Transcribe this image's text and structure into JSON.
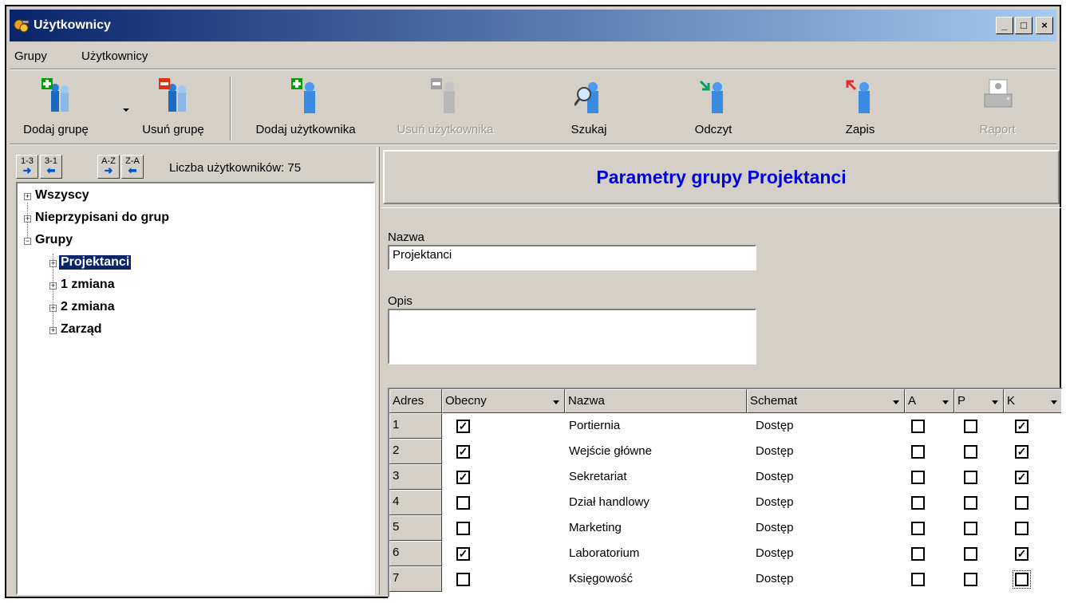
{
  "window": {
    "title": "Użytkownicy",
    "controls": {
      "minimize": "_",
      "maximize": "□",
      "close": "×"
    }
  },
  "menu": [
    {
      "label": "Grupy"
    },
    {
      "label": "Użytkownicy"
    }
  ],
  "toolbar": {
    "add_group": "Dodaj grupę",
    "remove_group": "Usuń grupę",
    "add_user": "Dodaj użytkownika",
    "remove_user": "Usuń użytkownika",
    "search": "Szukaj",
    "read": "Odczyt",
    "save": "Zapis",
    "report": "Raport"
  },
  "sort_buttons": [
    {
      "label": "1-3",
      "arrow": "➜"
    },
    {
      "label": "3-1",
      "arrow": "⬅"
    },
    {
      "label": "A-Z",
      "arrow": "➜"
    },
    {
      "label": "Z-A",
      "arrow": "⬅"
    }
  ],
  "user_count": "Liczba użytkowników: 75",
  "tree": {
    "all": "Wszyscy",
    "unassigned": "Nieprzypisani do grup",
    "groups": "Grupy",
    "group_items": [
      "Projektanci",
      "1 zmiana",
      "2 zmiana",
      "Zarząd"
    ],
    "selected": "Projektanci"
  },
  "panel": {
    "title": "Parametry grupy Projektanci",
    "name_label": "Nazwa",
    "name_value": "Projektanci",
    "desc_label": "Opis",
    "desc_value": ""
  },
  "grid": {
    "columns": [
      "Adres",
      "Obecny",
      "Nazwa",
      "Schemat",
      "A",
      "P",
      "K"
    ],
    "rows": [
      {
        "adres": "1",
        "obecny": true,
        "nazwa": "Portiernia",
        "schemat": "Dostęp",
        "a": false,
        "p": false,
        "k": true
      },
      {
        "adres": "2",
        "obecny": true,
        "nazwa": "Wejście główne",
        "schemat": "Dostęp",
        "a": false,
        "p": false,
        "k": true
      },
      {
        "adres": "3",
        "obecny": true,
        "nazwa": "Sekretariat",
        "schemat": "Dostęp",
        "a": false,
        "p": false,
        "k": true
      },
      {
        "adres": "4",
        "obecny": false,
        "nazwa": "Dział handlowy",
        "schemat": "Dostęp",
        "a": false,
        "p": false,
        "k": false
      },
      {
        "adres": "5",
        "obecny": false,
        "nazwa": "Marketing",
        "schemat": "Dostęp",
        "a": false,
        "p": false,
        "k": false
      },
      {
        "adres": "6",
        "obecny": true,
        "nazwa": "Laboratorium",
        "schemat": "Dostęp",
        "a": false,
        "p": false,
        "k": true
      },
      {
        "adres": "7",
        "obecny": false,
        "nazwa": "Księgowość",
        "schemat": "Dostęp",
        "a": false,
        "p": false,
        "k": false
      }
    ],
    "check_mark": "✓"
  },
  "colors": {
    "titlebar_start": "#0a246a",
    "titlebar_end": "#a6caf0",
    "panel_title": "#0000e0",
    "selection": "#0a246a",
    "face": "#d4d0c8"
  }
}
